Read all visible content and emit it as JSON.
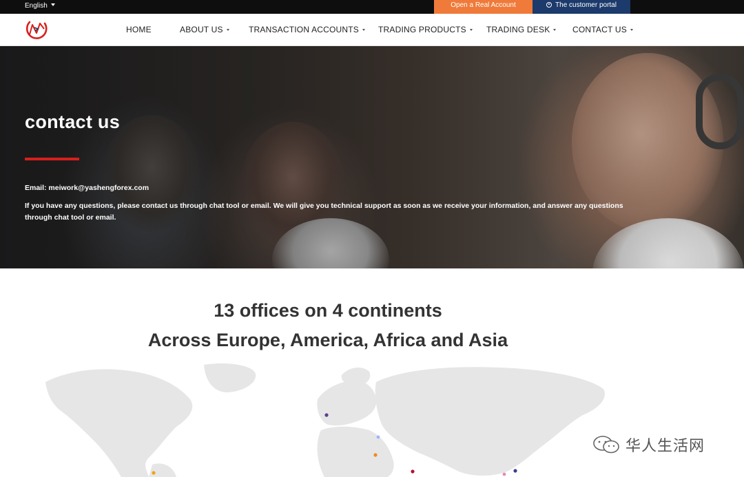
{
  "topbar": {
    "language": "English",
    "open_account": "Open a Real Account",
    "portal": "The customer portal"
  },
  "nav": {
    "items": [
      {
        "label": "HOME",
        "has_dropdown": false
      },
      {
        "label": "ABOUT US",
        "has_dropdown": true
      },
      {
        "label": "TRANSACTION ACCOUNTS",
        "has_dropdown": true
      },
      {
        "label": "TRADING PRODUCTS",
        "has_dropdown": true
      },
      {
        "label": "TRADING DESK",
        "has_dropdown": true
      },
      {
        "label": "CONTACT US",
        "has_dropdown": true
      }
    ]
  },
  "hero": {
    "title": "contact us",
    "email_line": "Email: meiwork@yashengforex.com",
    "body": "If you have any questions, please contact us through chat tool or email. We will give you technical support as soon as we receive your information, and answer any questions through chat tool or email."
  },
  "offices": {
    "heading_line1": "13 offices on 4 continents",
    "heading_line2": "Across Europe, America, Africa and Asia"
  },
  "watermark": {
    "text": "华人生活网"
  },
  "colors": {
    "topbar_bg": "#0e0e0e",
    "open_account_bg": "#ef7a3a",
    "portal_bg": "#1c3a6b",
    "accent_red": "#d8201c",
    "heading_text": "#333333",
    "map_land": "#e6e6e6"
  },
  "icons": {
    "language_caret": "caret-down-icon",
    "portal": "user-circle-icon",
    "logo": "company-logo",
    "nav_caret": "caret-down-icon",
    "watermark": "wechat-icon"
  }
}
